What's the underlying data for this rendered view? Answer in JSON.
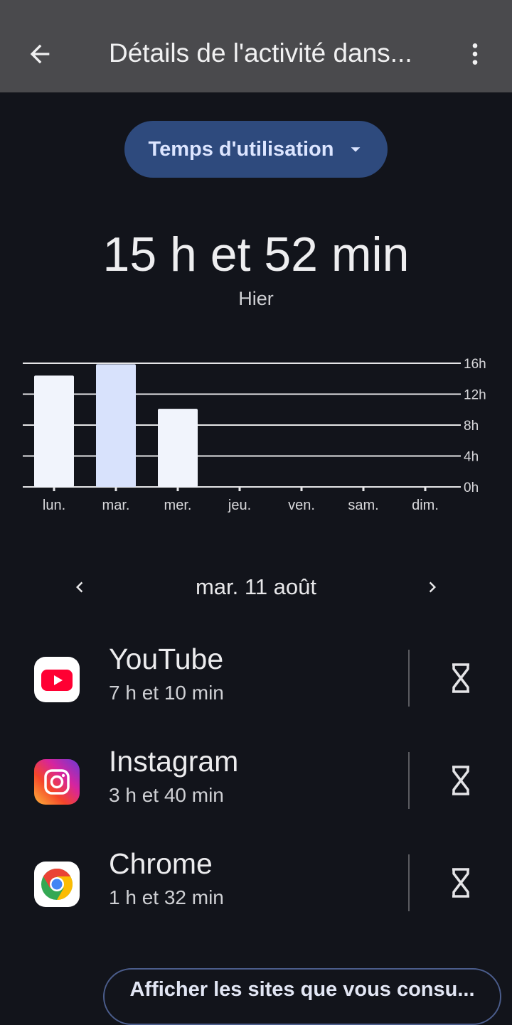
{
  "header": {
    "title": "Détails de l'activité dans...",
    "back_icon": "arrow-left-icon",
    "more_icon": "more-vert-icon"
  },
  "metric_selector": {
    "label": "Temps d'utilisation",
    "icon": "dropdown-arrow-icon"
  },
  "summary": {
    "total": "15 h et 52 min",
    "period": "Hier"
  },
  "chart_data": {
    "type": "bar",
    "categories": [
      "lun.",
      "mar.",
      "mer.",
      "jeu.",
      "ven.",
      "sam.",
      "dim."
    ],
    "values": [
      14.4,
      15.87,
      10.1,
      0,
      0,
      0,
      0
    ],
    "highlight_index": 1,
    "y_ticks": [
      "0h",
      "4h",
      "8h",
      "12h",
      "16h"
    ],
    "ylim": [
      0,
      16
    ],
    "grid": true,
    "colors": {
      "bar": "#f1f4fc",
      "bar_highlight": "#d8e2fc",
      "grid": "#e6e6e8"
    }
  },
  "date_nav": {
    "label": "mar. 11 août",
    "prev_icon": "chevron-left-icon",
    "next_icon": "chevron-right-icon"
  },
  "apps": [
    {
      "name": "YouTube",
      "time": "7 h et 10 min",
      "icon": "youtube-icon"
    },
    {
      "name": "Instagram",
      "time": "3 h et 40 min",
      "icon": "instagram-icon"
    },
    {
      "name": "Chrome",
      "time": "1 h et 32 min",
      "icon": "chrome-icon"
    }
  ],
  "sites_button": {
    "label": "Afficher les sites que vous consu..."
  },
  "colors": {
    "background": "#12141b",
    "topbar": "#4a4a4d",
    "accent_pill": "#2e4a7d"
  }
}
